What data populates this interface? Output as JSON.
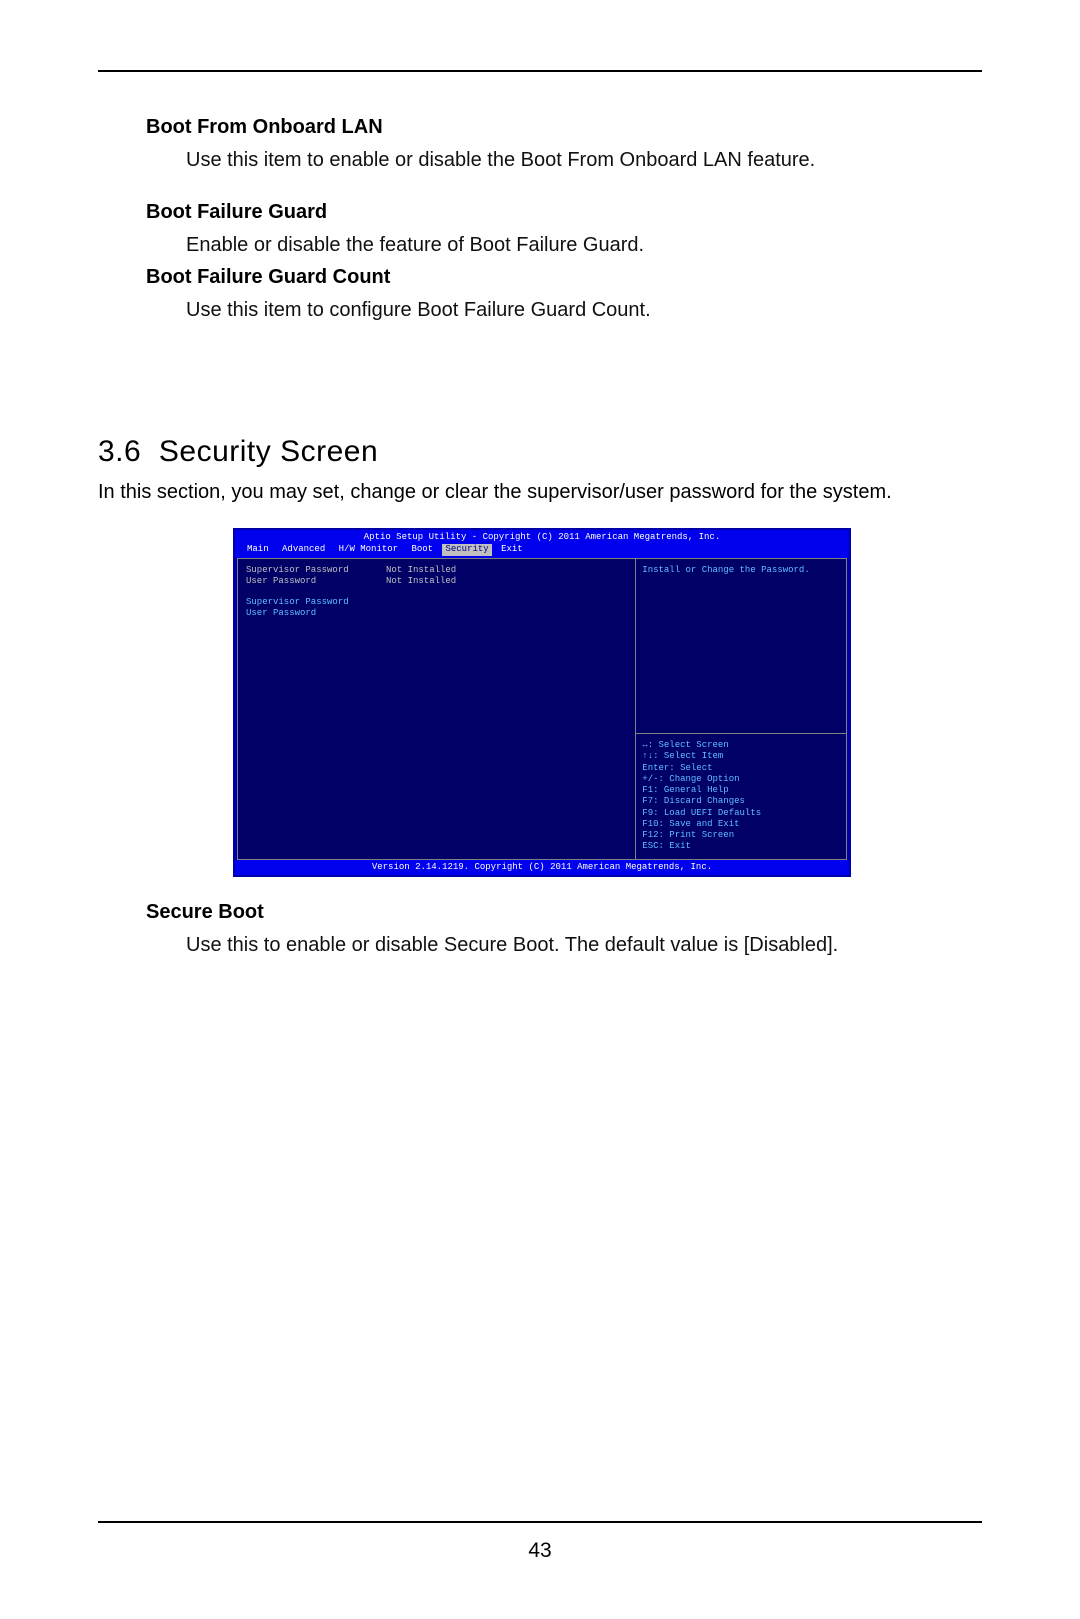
{
  "pageNumber": "43",
  "items_prefix": [
    {
      "heading": "Boot From Onboard LAN",
      "desc": "Use this item to enable or disable the Boot From Onboard LAN feature."
    },
    {
      "heading": "Boot Failure Guard",
      "desc": "Enable or disable the feature of Boot Failure Guard."
    },
    {
      "heading": "Boot Failure Guard Count",
      "desc": "Use this item to configure Boot Failure Guard Count."
    }
  ],
  "section": {
    "number": "3.6",
    "title": "Security Screen",
    "intro": "In this section, you may set, change or clear the supervisor/user password for the system."
  },
  "bios": {
    "topbar": "Aptio Setup Utility - Copyright (C) 2011 American Megatrends, Inc.",
    "tabs": [
      "Main",
      "Advanced",
      "H/W Monitor",
      "Boot",
      "Security",
      "Exit"
    ],
    "active_tab": "Security",
    "rows": [
      {
        "label": "Supervisor Password",
        "value": "Not Installed"
      },
      {
        "label": "User Password",
        "value": "Not Installed"
      }
    ],
    "links": [
      "Supervisor Password",
      "User Password"
    ],
    "helpTop": "Install or Change the Password.",
    "helpBottom": [
      "↔: Select Screen",
      "↑↓: Select Item",
      "Enter: Select",
      "+/-: Change Option",
      "F1: General Help",
      "F7: Discard Changes",
      "F9: Load UEFI Defaults",
      "F10: Save and Exit",
      "F12: Print Screen",
      "ESC: Exit"
    ],
    "footer": "Version 2.14.1219. Copyright (C) 2011 American Megatrends, Inc."
  },
  "items_suffix": [
    {
      "heading": "Secure Boot",
      "desc": "Use this to enable or disable Secure Boot. The default value is [Disabled]."
    }
  ]
}
